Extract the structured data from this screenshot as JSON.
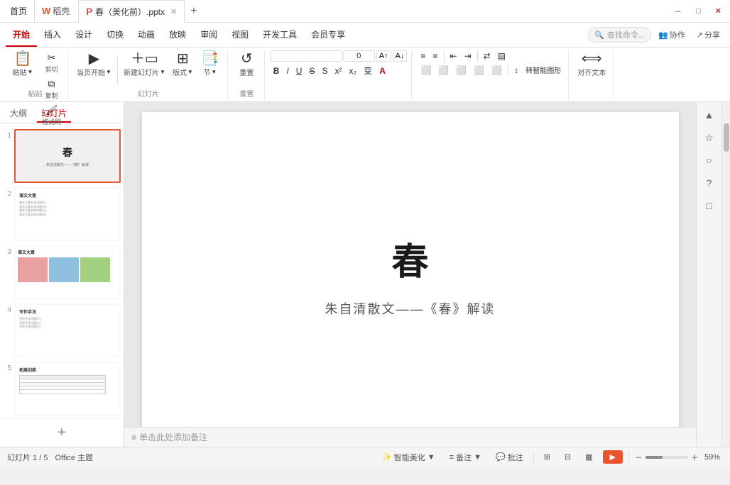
{
  "titlebar": {
    "home_tab": "首页",
    "wps_label": "稻壳",
    "file_tab": "春（美化前）.pptx",
    "new_tab_icon": "+",
    "right_btns": [
      "最小化",
      "最大化",
      "关闭"
    ]
  },
  "ribbon": {
    "tabs": [
      "开始",
      "插入",
      "设计",
      "切换",
      "动画",
      "放映",
      "审阅",
      "视图",
      "开发工具",
      "会员专享"
    ],
    "active_tab": "开始",
    "search_placeholder": "查找命令...",
    "groups": {
      "clipboard": {
        "label": "粘贴",
        "paste": "粘贴",
        "cut": "剪切",
        "copy": "复制",
        "format_paint": "格式刷"
      },
      "slide": {
        "label": "幻灯片",
        "new": "新建幻灯片",
        "start": "当页开始",
        "layout": "版式",
        "section": "节"
      },
      "redo": {
        "label": "重置",
        "redo": "重置"
      },
      "font": {
        "label": "",
        "font_name": "",
        "font_size": "0",
        "bold": "B",
        "italic": "I",
        "underline": "U",
        "strikethrough": "S",
        "superscript": "x²",
        "subscript": "x₂",
        "shadow": "S",
        "char_spacing": "变"
      },
      "paragraph": {
        "label": "",
        "align_left": "≡",
        "align_center": "≡",
        "align_right": "≡",
        "justify": "≡",
        "columns": "▤",
        "line_spacing": "↕"
      }
    },
    "right_btns": {
      "collaborate": "协作",
      "share": "分享",
      "smart_beauty": "智能美化",
      "note": "备注",
      "review": "批注"
    }
  },
  "left_panel": {
    "tabs": [
      "大纲",
      "幻灯片"
    ],
    "active_tab": "幻灯片",
    "slides": [
      {
        "num": "1",
        "title": "春",
        "subtitle": "朱自清散文——《春》解读",
        "active": true
      },
      {
        "num": "2",
        "title": "课文大意",
        "content": "文本内容...",
        "active": false
      },
      {
        "num": "3",
        "title": "课文大意",
        "has_images": true,
        "active": false
      },
      {
        "num": "4",
        "title": "写作手法",
        "content": "文本内容...",
        "active": false
      },
      {
        "num": "5",
        "title": "拓展训练",
        "has_table": true,
        "active": false
      }
    ],
    "add_slide": "+"
  },
  "slide": {
    "title": "春",
    "subtitle": "朱自清散文——《春》解读",
    "note_placeholder": "单击此处添加备注"
  },
  "right_panel": {
    "icons": [
      "▲",
      "☆",
      "○",
      "?",
      "□"
    ]
  },
  "statusbar": {
    "slide_info": "幻灯片 1 / 5",
    "theme": "Office 主题",
    "smart_beauty": "智能美化",
    "note_btn": "备注",
    "review_btn": "批注",
    "view_icons": [
      "⊞",
      "⊟",
      "▦"
    ],
    "play_btn": "▶",
    "zoom": "59%",
    "zoom_minus": "－",
    "zoom_plus": "＋"
  }
}
